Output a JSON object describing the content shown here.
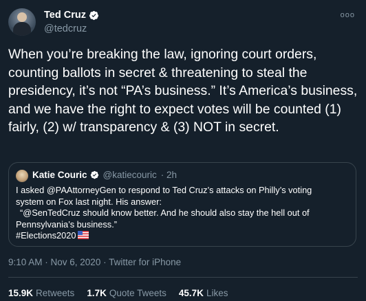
{
  "author": {
    "display_name": "Ted Cruz",
    "handle": "@tedcruz"
  },
  "more_label": "ooo",
  "tweet_text": "When you’re breaking the law, ignoring court orders, counting ballots in secret & threatening to steal the presidency, it’s not “PA’s business.”  It’s America’s business, and we have the right to expect votes will be counted (1) fairly, (2) w/ transparency & (3) NOT in secret.",
  "quoted_tweet": {
    "display_name": "Katie Couric",
    "handle": "@katiecouric",
    "time": "· 2h",
    "lines": [
      "I asked @PAAttorneyGen to respond to Ted Cruz’s attacks on Philly’s voting",
      "system on Fox last night. His answer:",
      "“@SenTedCruz should know better. And he should also stay the hell out of",
      "Pennsylvania’s business.”",
      "#Elections2020"
    ]
  },
  "meta": "9:10 AM · Nov 6, 2020 · Twitter for iPhone",
  "stats": [
    {
      "value": "15.9K",
      "label": "Retweets"
    },
    {
      "value": "1.7K",
      "label": "Quote Tweets"
    },
    {
      "value": "45.7K",
      "label": "Likes"
    }
  ],
  "colors": {
    "background": "#15202b",
    "secondary_text": "#8899a6",
    "border": "#38444d",
    "verified": "#1da1f2"
  },
  "icons": {
    "verified": "verified-badge-icon",
    "flag": "us-flag-emoji-icon",
    "more": "more-options-icon"
  }
}
